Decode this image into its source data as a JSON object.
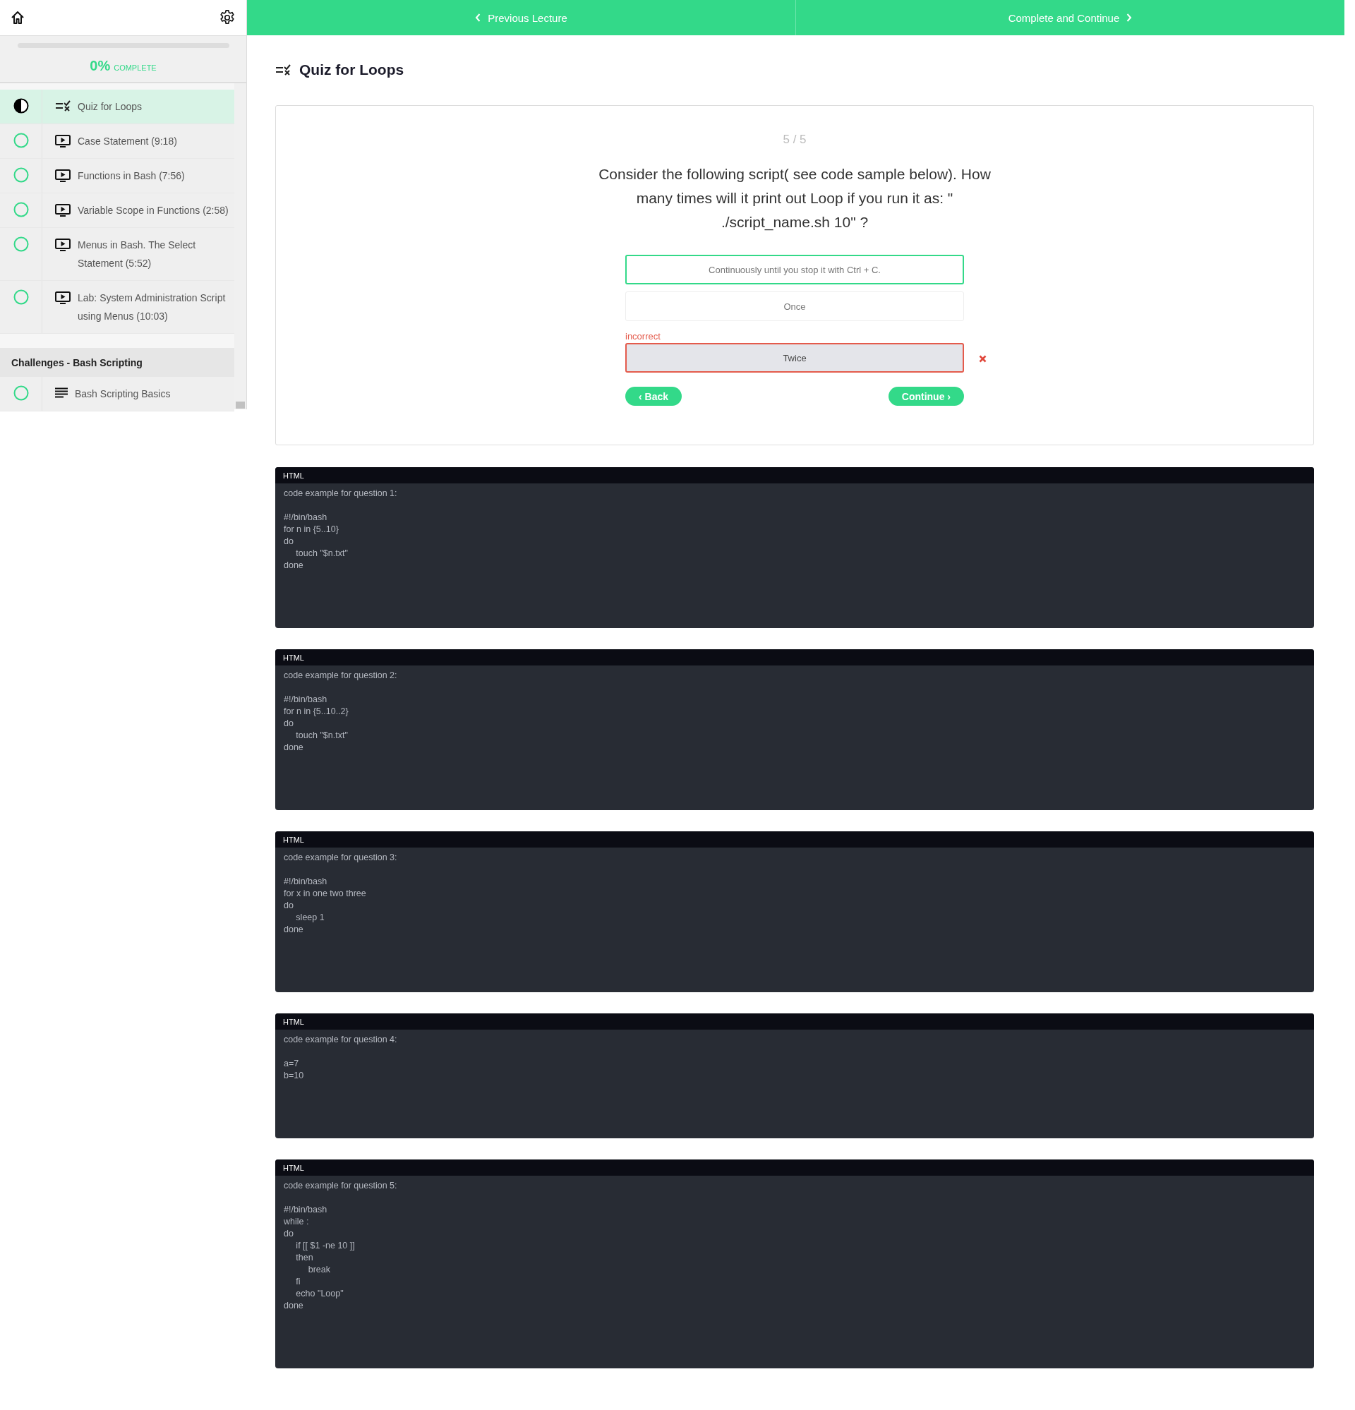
{
  "sidebar": {
    "progress": {
      "percent": "0%",
      "label": "COMPLETE",
      "level": 0
    },
    "sections": [
      {
        "items": [
          {
            "title": "Quiz for Loops",
            "kind": "quiz",
            "in_progress": true,
            "selected": true
          },
          {
            "title": "Case Statement (9:18)",
            "kind": "video",
            "in_progress": false,
            "selected": false
          },
          {
            "title": "Functions in Bash (7:56)",
            "kind": "video",
            "in_progress": false,
            "selected": false
          },
          {
            "title": "Variable Scope in Functions (2:58)",
            "kind": "video",
            "in_progress": false,
            "selected": false
          },
          {
            "title": "Menus in Bash. The Select Statement (5:52)",
            "kind": "video",
            "in_progress": false,
            "selected": false
          },
          {
            "title": "Lab: System Administration Script using Menus (10:03)",
            "kind": "video",
            "in_progress": false,
            "selected": false
          }
        ]
      },
      {
        "title": "Challenges - Bash Scripting",
        "items": [
          {
            "title": "Bash Scripting Basics",
            "kind": "text",
            "in_progress": false,
            "selected": false
          }
        ]
      }
    ]
  },
  "nav": {
    "previous": "Previous Lecture",
    "next": "Complete and Continue"
  },
  "lecture": {
    "title": "Quiz for Loops"
  },
  "quiz": {
    "counter": "5 / 5",
    "question": "Consider the following script( see code sample below). How many times will it print out Loop if you run it as: \" ./script_name.sh 10\" ?",
    "answers": [
      {
        "text": "Continuously until you stop it with Ctrl + C.",
        "correct": true,
        "selected": false
      },
      {
        "text": "Once",
        "correct": false,
        "selected": false
      },
      {
        "text": "Twice",
        "correct": false,
        "selected": true,
        "feedback": "incorrect"
      }
    ],
    "back": "‹ Back",
    "continue": "Continue ›"
  },
  "code_blocks": [
    {
      "language": "HTML",
      "caption": "code example for question 1:",
      "lines": [
        "#!/bin/bash",
        "for n in {5..10}",
        "do",
        "     touch \"$n.txt\"",
        "done"
      ]
    },
    {
      "language": "HTML",
      "caption": "code example for question 2:",
      "lines": [
        "#!/bin/bash",
        "for n in {5..10..2}",
        "do",
        "     touch \"$n.txt\"",
        "done"
      ]
    },
    {
      "language": "HTML",
      "caption": "code example for question 3:",
      "lines": [
        "#!/bin/bash",
        "for x in one two three",
        "do",
        "     sleep 1",
        "done"
      ]
    },
    {
      "language": "HTML",
      "caption": "code example for question 4:",
      "lines": [
        "a=7",
        "b=10"
      ]
    },
    {
      "language": "HTML",
      "caption": "code example for question 5:",
      "lines": [
        "#!/bin/bash",
        "while :",
        "do",
        "     if [[ $1 -ne 10 ]]",
        "     then",
        "          break",
        "     fi",
        "     echo \"Loop\"",
        "done"
      ]
    }
  ]
}
